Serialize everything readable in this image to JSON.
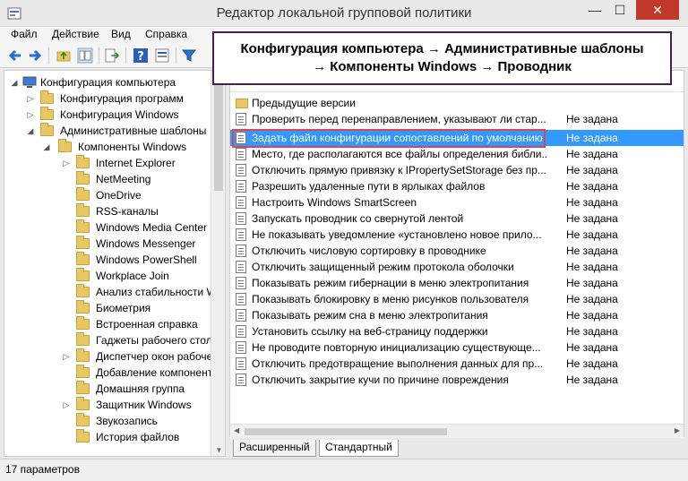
{
  "window": {
    "title": "Редактор локальной групповой политики",
    "close_symbol": "✕",
    "minimize_symbol": "—",
    "maximize_symbol": "☐"
  },
  "menu": [
    "Файл",
    "Действие",
    "Вид",
    "Справка"
  ],
  "toolbar": {
    "buttons": [
      "back-arrow-icon",
      "forward-arrow-icon",
      "folder-up-icon",
      "details-view-icon",
      "export-icon",
      "help-icon",
      "properties-icon",
      "filter-icon"
    ]
  },
  "banner": {
    "text": "Конфигурация компьютера → Административные шаблоны → Компоненты Windows → Проводник"
  },
  "tree": {
    "items": [
      {
        "label": "Конфигурация компьютера",
        "level": 0,
        "expanded": true,
        "icon": "computer"
      },
      {
        "label": "Конфигурация программ",
        "level": 1,
        "expanded": false,
        "icon": "folder"
      },
      {
        "label": "Конфигурация Windows",
        "level": 1,
        "expanded": false,
        "icon": "folder"
      },
      {
        "label": "Административные шаблоны",
        "level": 1,
        "expanded": true,
        "icon": "folder"
      },
      {
        "label": "Компоненты Windows",
        "level": 2,
        "expanded": true,
        "icon": "folder"
      },
      {
        "label": "Internet Explorer",
        "level": 3,
        "expanded": false,
        "icon": "folder"
      },
      {
        "label": "NetMeeting",
        "level": 3,
        "expanded": null,
        "icon": "folder"
      },
      {
        "label": "OneDrive",
        "level": 3,
        "expanded": null,
        "icon": "folder"
      },
      {
        "label": "RSS-каналы",
        "level": 3,
        "expanded": null,
        "icon": "folder"
      },
      {
        "label": "Windows Media Center",
        "level": 3,
        "expanded": null,
        "icon": "folder"
      },
      {
        "label": "Windows Messenger",
        "level": 3,
        "expanded": null,
        "icon": "folder"
      },
      {
        "label": "Windows PowerShell",
        "level": 3,
        "expanded": null,
        "icon": "folder"
      },
      {
        "label": "Workplace Join",
        "level": 3,
        "expanded": null,
        "icon": "folder"
      },
      {
        "label": "Анализ стабильности W",
        "level": 3,
        "expanded": null,
        "icon": "folder"
      },
      {
        "label": "Биометрия",
        "level": 3,
        "expanded": null,
        "icon": "folder"
      },
      {
        "label": "Встроенная справка",
        "level": 3,
        "expanded": null,
        "icon": "folder"
      },
      {
        "label": "Гаджеты рабочего стол",
        "level": 3,
        "expanded": null,
        "icon": "folder"
      },
      {
        "label": "Диспетчер окон рабоче",
        "level": 3,
        "expanded": false,
        "icon": "folder"
      },
      {
        "label": "Добавление компонент",
        "level": 3,
        "expanded": null,
        "icon": "folder"
      },
      {
        "label": "Домашняя группа",
        "level": 3,
        "expanded": null,
        "icon": "folder"
      },
      {
        "label": "Защитник Windows",
        "level": 3,
        "expanded": false,
        "icon": "folder"
      },
      {
        "label": "Звукозапись",
        "level": 3,
        "expanded": null,
        "icon": "folder"
      },
      {
        "label": "История файлов",
        "level": 3,
        "expanded": null,
        "icon": "folder"
      }
    ]
  },
  "list": {
    "rows": [
      {
        "name": "Предыдущие версии",
        "state": "",
        "icon": "folder",
        "selected": false
      },
      {
        "name": "Проверить перед перенаправлением, указывают ли стар...",
        "state": "Не задана",
        "icon": "setting",
        "selected": false
      },
      {
        "name": "Задать файл конфигурации сопоставлений по умолчанию",
        "state": "Не задана",
        "icon": "setting",
        "selected": true
      },
      {
        "name": "Место, где располагаются все файлы определения библи...",
        "state": "Не задана",
        "icon": "setting",
        "selected": false
      },
      {
        "name": "Отключить прямую привязку к IPropertySetStorage без пр...",
        "state": "Не задана",
        "icon": "setting",
        "selected": false
      },
      {
        "name": "Разрешить удаленные пути в ярлыках файлов",
        "state": "Не задана",
        "icon": "setting",
        "selected": false
      },
      {
        "name": "Настроить Windows SmartScreen",
        "state": "Не задана",
        "icon": "setting",
        "selected": false
      },
      {
        "name": "Запускать проводник со свернутой лентой",
        "state": "Не задана",
        "icon": "setting",
        "selected": false
      },
      {
        "name": "Не показывать уведомление «установлено новое прило...",
        "state": "Не задана",
        "icon": "setting",
        "selected": false
      },
      {
        "name": "Отключить числовую сортировку в проводнике",
        "state": "Не задана",
        "icon": "setting",
        "selected": false
      },
      {
        "name": "Отключить защищенный режим протокола оболочки",
        "state": "Не задана",
        "icon": "setting",
        "selected": false
      },
      {
        "name": "Показывать режим гибернации в меню электропитания",
        "state": "Не задана",
        "icon": "setting",
        "selected": false
      },
      {
        "name": "Показывать блокировку в меню рисунков пользователя",
        "state": "Не задана",
        "icon": "setting",
        "selected": false
      },
      {
        "name": "Показывать режим сна в меню электропитания",
        "state": "Не задана",
        "icon": "setting",
        "selected": false
      },
      {
        "name": "Установить ссылку на веб-страницу поддержки",
        "state": "Не задана",
        "icon": "setting",
        "selected": false
      },
      {
        "name": "Не проводите повторную инициализацию существующе...",
        "state": "Не задана",
        "icon": "setting",
        "selected": false
      },
      {
        "name": "Отключить предотвращение выполнения данных для пр...",
        "state": "Не задана",
        "icon": "setting",
        "selected": false
      },
      {
        "name": "Отключить закрытие кучи по причине повреждения",
        "state": "Не задана",
        "icon": "setting",
        "selected": false
      }
    ]
  },
  "tabs": [
    {
      "label": "Расширенный",
      "active": false
    },
    {
      "label": "Стандартный",
      "active": true
    }
  ],
  "status": {
    "text": "17 параметров"
  },
  "colors": {
    "selection": "#3399ff",
    "highlight_box": "#e0454f",
    "banner_border": "#4a1f4f"
  }
}
